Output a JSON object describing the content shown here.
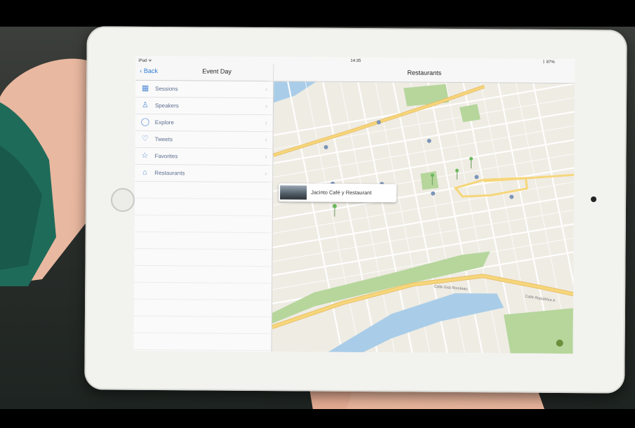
{
  "status_bar": {
    "carrier": "iPad ᯤ",
    "time": "14:35",
    "battery": "ᛒ 87%"
  },
  "master": {
    "back_label": "Back",
    "title": "Event Day",
    "items": [
      {
        "label": "Sessions",
        "icon": "grid-icon"
      },
      {
        "label": "Speakers",
        "icon": "person-icon"
      },
      {
        "label": "Explore",
        "icon": "compass-icon"
      },
      {
        "label": "Tweets",
        "icon": "bird-icon"
      },
      {
        "label": "Favorites",
        "icon": "star-icon"
      },
      {
        "label": "Restaurants",
        "icon": "fork-icon"
      }
    ]
  },
  "detail": {
    "title": "Restaurants",
    "callout": "Jacinto Café y Restaurant",
    "streets": [
      "Calle Gral Rondeau",
      "Calle República A"
    ]
  },
  "colors": {
    "accent": "#2d7ad6",
    "map_bg": "#efece4",
    "park": "#b6d69c",
    "water": "#a9cde8",
    "road": "#f6d67a"
  }
}
